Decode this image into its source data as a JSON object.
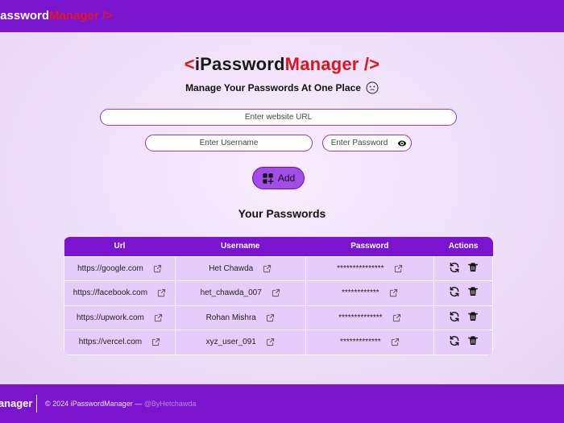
{
  "navbar": {
    "brand_part1": "iPassword",
    "brand_part2": "Manager />"
  },
  "hero": {
    "open": "<",
    "part1": "iPassword",
    "part2": "Manager />",
    "tagline": "Manage Your Passwords At One Place"
  },
  "form": {
    "url_placeholder": "Enter website URL",
    "username_placeholder": "Enter Username",
    "password_placeholder": "Enter Password",
    "add_label": "Add"
  },
  "table": {
    "title": "Your Passwords",
    "headers": [
      "Url",
      "Username",
      "Password",
      "Actions"
    ],
    "rows": [
      {
        "url": "https://google.com",
        "username": "Het Chawda",
        "password": "***************"
      },
      {
        "url": "https://facebook.com",
        "username": "het_chawda_007",
        "password": "************"
      },
      {
        "url": "https://upwork.com",
        "username": "Rohan Mishra",
        "password": "**************"
      },
      {
        "url": "https://vercel.com",
        "username": "xyz_user_091",
        "password": "*************"
      }
    ]
  },
  "footer": {
    "brand": "Manager",
    "copyright": "© 2024 iPasswordManager — ",
    "handle": "@ByHetchawda"
  },
  "colors": {
    "primary": "#7a14cf",
    "accent_red": "#e0141e",
    "button": "#a24de6",
    "row_bg": "#e6ccfa"
  },
  "icons": {
    "copy": "copy-icon",
    "edit": "edit-refresh-icon",
    "delete": "trash-icon",
    "eye": "eye-icon",
    "add": "add-grid-icon",
    "smiley": "smiley-icon"
  }
}
